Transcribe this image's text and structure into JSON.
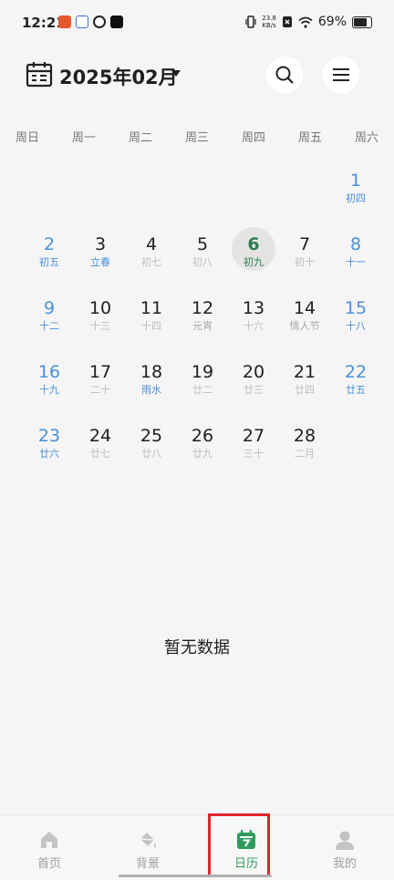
{
  "status_bar": {
    "time": "12:21",
    "speed_value": "23.8",
    "speed_unit": "KB/s",
    "battery": "69%",
    "battery_level": 0.69
  },
  "header": {
    "month_title": "2025年02月"
  },
  "weekdays": [
    "周日",
    "周一",
    "周二",
    "周三",
    "周四",
    "周五",
    "周六"
  ],
  "calendar": {
    "selected_day": 6,
    "days": [
      {
        "day": "1",
        "sub": "初四",
        "weekend": true,
        "kind": ""
      },
      {
        "day": "2",
        "sub": "初五",
        "weekend": true,
        "kind": ""
      },
      {
        "day": "3",
        "sub": "立春",
        "weekend": false,
        "kind": "term"
      },
      {
        "day": "4",
        "sub": "初七",
        "weekend": false,
        "kind": ""
      },
      {
        "day": "5",
        "sub": "初八",
        "weekend": false,
        "kind": ""
      },
      {
        "day": "6",
        "sub": "初九",
        "weekend": false,
        "kind": "today"
      },
      {
        "day": "7",
        "sub": "初十",
        "weekend": false,
        "kind": ""
      },
      {
        "day": "8",
        "sub": "十一",
        "weekend": true,
        "kind": ""
      },
      {
        "day": "9",
        "sub": "十二",
        "weekend": true,
        "kind": ""
      },
      {
        "day": "10",
        "sub": "十三",
        "weekend": false,
        "kind": ""
      },
      {
        "day": "11",
        "sub": "十四",
        "weekend": false,
        "kind": ""
      },
      {
        "day": "12",
        "sub": "元宵",
        "weekend": false,
        "kind": "festival"
      },
      {
        "day": "13",
        "sub": "十六",
        "weekend": false,
        "kind": ""
      },
      {
        "day": "14",
        "sub": "情人节",
        "weekend": false,
        "kind": "festival"
      },
      {
        "day": "15",
        "sub": "十八",
        "weekend": true,
        "kind": ""
      },
      {
        "day": "16",
        "sub": "十九",
        "weekend": true,
        "kind": ""
      },
      {
        "day": "17",
        "sub": "二十",
        "weekend": false,
        "kind": ""
      },
      {
        "day": "18",
        "sub": "雨水",
        "weekend": false,
        "kind": "term"
      },
      {
        "day": "19",
        "sub": "廿二",
        "weekend": false,
        "kind": ""
      },
      {
        "day": "20",
        "sub": "廿三",
        "weekend": false,
        "kind": ""
      },
      {
        "day": "21",
        "sub": "廿四",
        "weekend": false,
        "kind": ""
      },
      {
        "day": "22",
        "sub": "廿五",
        "weekend": true,
        "kind": ""
      },
      {
        "day": "23",
        "sub": "廿六",
        "weekend": true,
        "kind": ""
      },
      {
        "day": "24",
        "sub": "廿七",
        "weekend": false,
        "kind": ""
      },
      {
        "day": "25",
        "sub": "廿八",
        "weekend": false,
        "kind": ""
      },
      {
        "day": "26",
        "sub": "廿九",
        "weekend": false,
        "kind": ""
      },
      {
        "day": "27",
        "sub": "三十",
        "weekend": false,
        "kind": ""
      },
      {
        "day": "28",
        "sub": "二月",
        "weekend": false,
        "kind": ""
      }
    ]
  },
  "empty_state": {
    "text": "暂无数据"
  },
  "tabs": [
    {
      "label": "首页",
      "icon": "home-icon",
      "active": false
    },
    {
      "label": "背景",
      "icon": "paint-bucket-icon",
      "active": false
    },
    {
      "label": "日历",
      "icon": "calendar-icon",
      "active": true
    },
    {
      "label": "我的",
      "icon": "person-icon",
      "active": false
    }
  ],
  "colors": {
    "accent_green": "#2e9b5c",
    "weekend_blue": "#4a90d9",
    "highlight_red": "#e0242c"
  }
}
